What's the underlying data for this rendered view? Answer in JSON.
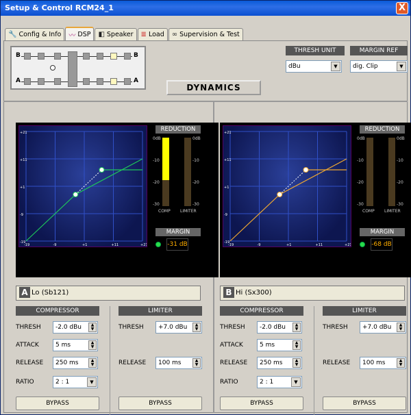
{
  "window": {
    "title": "Setup & Control RCM24_1",
    "close": "X"
  },
  "tabs": [
    {
      "label": "Config & Info",
      "icon": "wrench-icon"
    },
    {
      "label": "DSP",
      "icon": "dsp-icon"
    },
    {
      "label": "Speaker",
      "icon": "speaker-icon"
    },
    {
      "label": "Load",
      "icon": "load-icon"
    },
    {
      "label": "Supervision & Test",
      "icon": "glasses-icon"
    }
  ],
  "routing": {
    "top_in": "B",
    "top_out": "B",
    "bottom_in": "A",
    "bottom_out": "A"
  },
  "thresh_unit": {
    "label": "THRESH UNIT",
    "value": "dBu"
  },
  "margin_ref": {
    "label": "MARGIN REF",
    "value": "dig. Clip"
  },
  "dynamics_label": "DYNAMICS",
  "scale": {
    "y": [
      "+21",
      "+11",
      "+1",
      "-9",
      "-19"
    ],
    "x": [
      "-19",
      "-9",
      "+1",
      "+11",
      "+21"
    ],
    "meter": [
      "0dB",
      "-10",
      "-20",
      "-30"
    ]
  },
  "reduction_label": "REDUCTION",
  "margin_label": "MARGIN",
  "comp_label": "COMP",
  "limiter_meter_label": "LIMITER",
  "channels": [
    {
      "id": "A",
      "name": "Lo (Sb121)",
      "curve_color": "#1ec85a",
      "margin": "-31 dB",
      "comp_reduction": 0.62,
      "limiter_reduction": 0.0,
      "compressor": {
        "title": "COMPRESSOR",
        "thresh_label": "THRESH",
        "thresh": "-2.0 dBu",
        "attack_label": "ATTACK",
        "attack": "5 ms",
        "release_label": "RELEASE",
        "release": "250 ms",
        "ratio_label": "RATIO",
        "ratio": "2 : 1",
        "bypass": "BYPASS"
      },
      "limiter": {
        "title": "LIMITER",
        "thresh_label": "THRESH",
        "thresh": "+7.0 dBu",
        "release_label": "RELEASE",
        "release": "100 ms",
        "bypass": "BYPASS"
      }
    },
    {
      "id": "B",
      "name": "Hi (Sx300)",
      "curve_color": "#f0a830",
      "margin": "-68 dB",
      "comp_reduction": 0.0,
      "limiter_reduction": 0.0,
      "compressor": {
        "title": "COMPRESSOR",
        "thresh_label": "THRESH",
        "thresh": "-2.0 dBu",
        "attack_label": "ATTACK",
        "attack": "5 ms",
        "release_label": "RELEASE",
        "release": "250 ms",
        "ratio_label": "RATIO",
        "ratio": "2 : 1",
        "bypass": "BYPASS"
      },
      "limiter": {
        "title": "LIMITER",
        "thresh_label": "THRESH",
        "thresh": "+7.0 dBu",
        "release_label": "RELEASE",
        "release": "100 ms",
        "bypass": "BYPASS"
      }
    }
  ]
}
